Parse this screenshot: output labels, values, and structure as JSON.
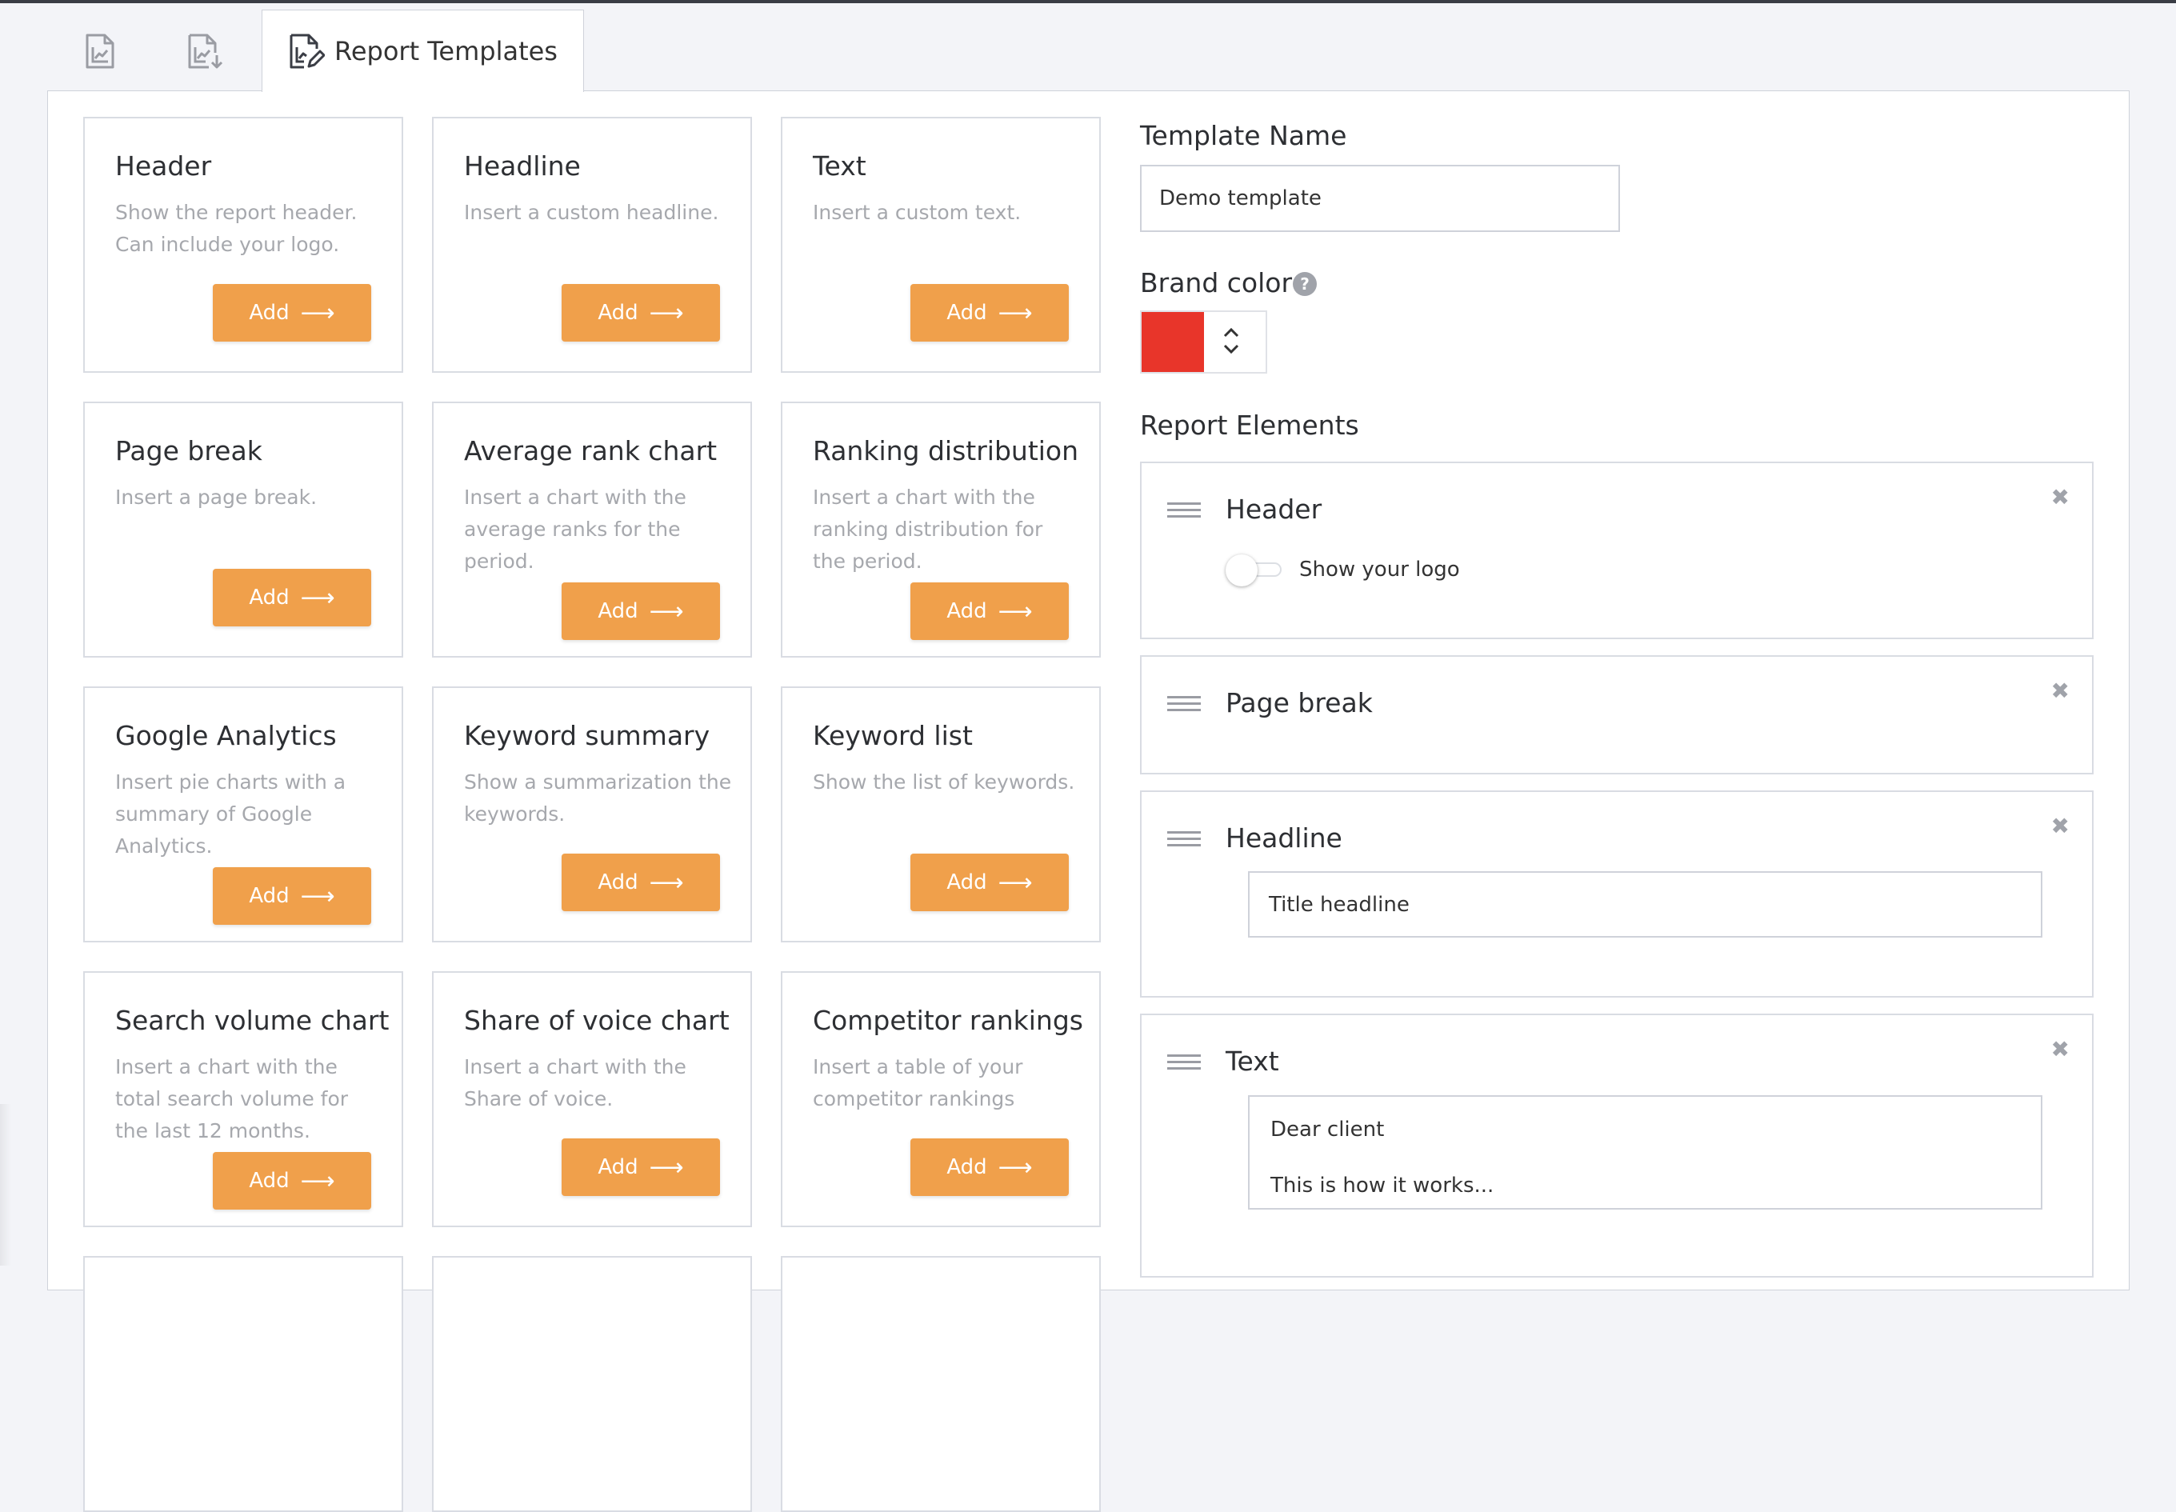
{
  "tabs": [
    {
      "name": "report",
      "label": ""
    },
    {
      "name": "report-export",
      "label": ""
    },
    {
      "name": "report-templates",
      "label": "Report Templates"
    }
  ],
  "cards": [
    {
      "title": "Header",
      "description": "Show the report header. Can include your logo.",
      "button": "Add"
    },
    {
      "title": "Headline",
      "description": "Insert a custom headline.",
      "button": "Add"
    },
    {
      "title": "Text",
      "description": "Insert a custom text.",
      "button": "Add"
    },
    {
      "title": "Page break",
      "description": "Insert a page break.",
      "button": "Add"
    },
    {
      "title": "Average rank chart",
      "description": "Insert a chart with the average ranks for the period.",
      "button": "Add"
    },
    {
      "title": "Ranking distribution",
      "description": "Insert a chart with the ranking distribution for the period.",
      "button": "Add"
    },
    {
      "title": "Google Analytics",
      "description": "Insert pie charts with a summary of Google Analytics.",
      "button": "Add"
    },
    {
      "title": "Keyword summary",
      "description": "Show a summarization the keywords.",
      "button": "Add"
    },
    {
      "title": "Keyword list",
      "description": "Show the list of keywords.",
      "button": "Add"
    },
    {
      "title": "Search volume chart",
      "description": "Insert a chart with the total search volume for the last 12 months.",
      "button": "Add"
    },
    {
      "title": "Share of voice chart",
      "description": "Insert a chart with the Share of voice.",
      "button": "Add"
    },
    {
      "title": "Competitor rankings",
      "description": "Insert a table of your competitor rankings",
      "button": "Add"
    }
  ],
  "button_arrow": "⟶",
  "template_name": {
    "label": "Template Name",
    "value": "Demo template"
  },
  "brand_color": {
    "label": "Brand color",
    "help": "?",
    "value": "#e8352a"
  },
  "report_elements": {
    "label": "Report Elements",
    "close": "✖",
    "header": {
      "title": "Header",
      "toggle_label": "Show your logo",
      "toggle_on": false
    },
    "page_break": {
      "title": "Page break"
    },
    "headline": {
      "title": "Headline",
      "value": "Title headline"
    },
    "text": {
      "title": "Text",
      "line1": "Dear client",
      "line2": "This is how it works..."
    }
  },
  "colors": {
    "accent": "#f0a04b",
    "brand": "#e8352a",
    "border": "#d9dce3"
  }
}
